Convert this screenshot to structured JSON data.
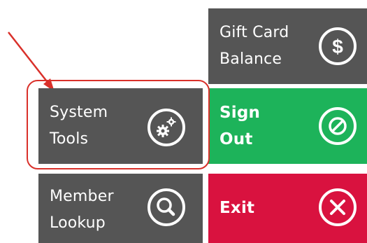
{
  "colors": {
    "tile_gray": "#555555",
    "tile_green": "#1db35a",
    "tile_red": "#d9123f",
    "highlight_red": "#d9302a",
    "icon_white": "#ffffff"
  },
  "tiles": {
    "gift_card": {
      "label": "Gift Card\nBalance",
      "icon": "dollar-circle-icon"
    },
    "system_tools": {
      "label": "System\nTools",
      "icon": "gears-icon"
    },
    "sign_out": {
      "label": "Sign\nOut",
      "icon": "prohibit-circle-icon"
    },
    "member_lookup": {
      "label": "Member\nLookup",
      "icon": "search-magnifier-icon"
    },
    "exit": {
      "label": "Exit",
      "icon": "close-x-icon"
    }
  },
  "annotation": {
    "arrow": "red-arrow-pointer",
    "highlight": "red-rounded-highlight"
  }
}
